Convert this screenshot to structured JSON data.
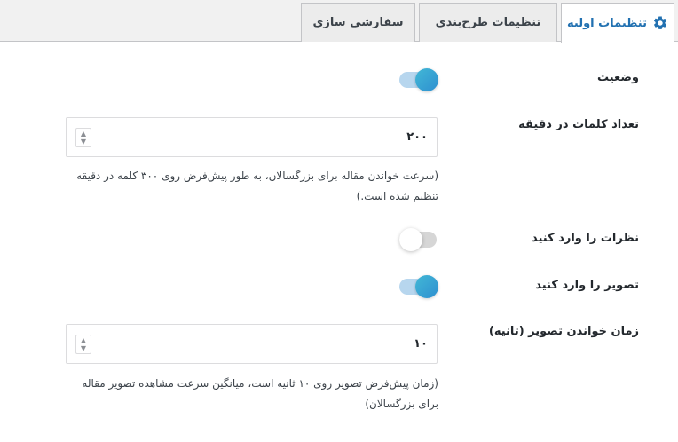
{
  "tabs": [
    {
      "label": "تنظیمات اولیه",
      "active": true,
      "icon": "gear-icon"
    },
    {
      "label": "تنظیمات طرح‌بندی",
      "active": false
    },
    {
      "label": "سفارشی سازی",
      "active": false
    }
  ],
  "fields": {
    "status": {
      "label": "وضعیت",
      "enabled": true
    },
    "words_per_minute": {
      "label": "تعداد کلمات در دقیقه",
      "value": "۲۰۰",
      "help": "(سرعت خواندن مقاله برای بزرگسالان، به طور پیش‌فرض روی ۳۰۰ کلمه در دقیقه تنظیم شده است.)"
    },
    "include_comments": {
      "label": "نظرات را وارد کنید",
      "enabled": false
    },
    "include_images": {
      "label": "تصویر را وارد کنید",
      "enabled": true
    },
    "image_read_time": {
      "label": "زمان خواندن تصویر (ثانیه)",
      "value": "۱۰",
      "help": "(زمان پیش‌فرض تصویر روی ۱۰ ثانیه است، میانگین سرعت مشاهده تصویر مقاله برای بزرگسالان)"
    }
  },
  "colors": {
    "accent": "#2271b1",
    "toggle_on": "#2e8fd0",
    "toggle_track_on": "#b7d6ee",
    "toggle_track_off": "#d6d6d6"
  }
}
